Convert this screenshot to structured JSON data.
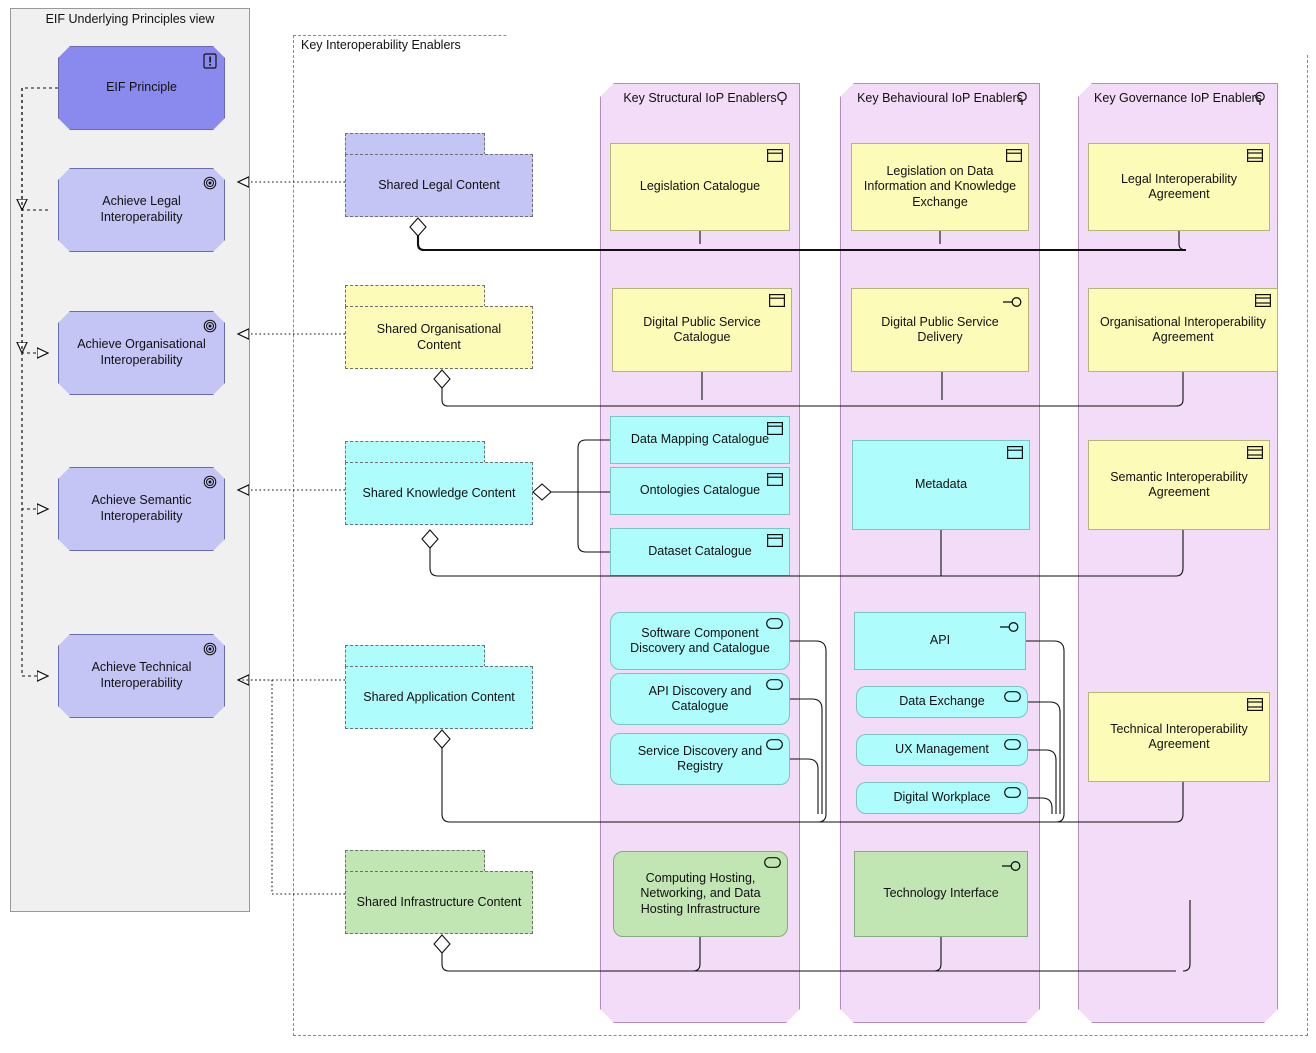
{
  "left_view": {
    "title": "EIF Underlying Principles view",
    "principle": {
      "label": "EIF Principle",
      "icon": "principle-icon"
    },
    "goals": [
      {
        "label": "Achieve Legal Interoperability",
        "icon": "goal-icon"
      },
      {
        "label": "Achieve Organisational Interoperability",
        "icon": "goal-icon"
      },
      {
        "label": "Achieve Semantic Interoperability",
        "icon": "goal-icon"
      },
      {
        "label": "Achieve Technical Interoperability",
        "icon": "goal-icon"
      }
    ]
  },
  "enablers_group": {
    "title": "Key Interoperability Enablers"
  },
  "packages": [
    {
      "label": "Shared Legal Content",
      "layer": "motivation"
    },
    {
      "label": "Shared Organisational Content",
      "layer": "business"
    },
    {
      "label": "Shared Knowledge Content",
      "layer": "application"
    },
    {
      "label": "Shared Application Content",
      "layer": "application"
    },
    {
      "label": "Shared Infrastructure Content",
      "layer": "technology"
    }
  ],
  "columns": [
    {
      "title": "Key Structural IoP Enablers",
      "icon": "magnifier-icon"
    },
    {
      "title": "Key Behavioural IoP Enablers",
      "icon": "magnifier-icon"
    },
    {
      "title": "Key Governance IoP Enablers",
      "icon": "magnifier-icon"
    }
  ],
  "elements": {
    "structural": [
      {
        "label": "Legislation Catalogue",
        "layer": "business",
        "icon": "business-object-icon"
      },
      {
        "label": "Digital Public Service Catalogue",
        "layer": "business",
        "icon": "business-object-icon"
      },
      {
        "label": "Data Mapping Catalogue",
        "layer": "application",
        "icon": "business-object-icon"
      },
      {
        "label": "Ontologies Catalogue",
        "layer": "application",
        "icon": "business-object-icon"
      },
      {
        "label": "Dataset Catalogue",
        "layer": "application",
        "icon": "business-object-icon"
      },
      {
        "label": "Software Component Discovery and Catalogue",
        "layer": "application",
        "icon": "application-service-icon"
      },
      {
        "label": "API Discovery and Catalogue",
        "layer": "application",
        "icon": "application-service-icon"
      },
      {
        "label": "Service Discovery and Registry",
        "layer": "application",
        "icon": "application-service-icon"
      },
      {
        "label": "Computing Hosting, Networking, and Data Hosting Infrastructure",
        "layer": "technology",
        "icon": "technology-service-icon"
      }
    ],
    "behavioural": [
      {
        "label": "Legislation on Data Information and Knowledge Exchange",
        "layer": "business",
        "icon": "business-object-icon"
      },
      {
        "label": "Digital Public Service Delivery",
        "layer": "business",
        "icon": "interface-icon"
      },
      {
        "label": "Metadata",
        "layer": "application",
        "icon": "business-object-icon"
      },
      {
        "label": "API",
        "layer": "application",
        "icon": "interface-icon"
      },
      {
        "label": "Data Exchange",
        "layer": "application",
        "icon": "application-service-icon"
      },
      {
        "label": "UX Management",
        "layer": "application",
        "icon": "application-service-icon"
      },
      {
        "label": "Digital Workplace",
        "layer": "application",
        "icon": "application-service-icon"
      },
      {
        "label": "Technology Interface",
        "layer": "technology",
        "icon": "interface-icon"
      }
    ],
    "governance": [
      {
        "label": "Legal Interoperability Agreement",
        "layer": "business",
        "icon": "contract-icon"
      },
      {
        "label": "Organisational Interoperability Agreement",
        "layer": "business",
        "icon": "contract-icon"
      },
      {
        "label": "Semantic Interoperability Agreement",
        "layer": "business",
        "icon": "contract-icon"
      },
      {
        "label": "Technical Interoperability Agreement",
        "layer": "business",
        "icon": "contract-icon"
      }
    ]
  },
  "colors": {
    "motivation_principle": "#8a8aee",
    "motivation_goal": "#c4c4f5",
    "business": "#fdfbb8",
    "application": "#aefcfc",
    "technology": "#c2e5b4",
    "grouping": "#f3dcf7",
    "view_background": "#f0f0f0"
  }
}
